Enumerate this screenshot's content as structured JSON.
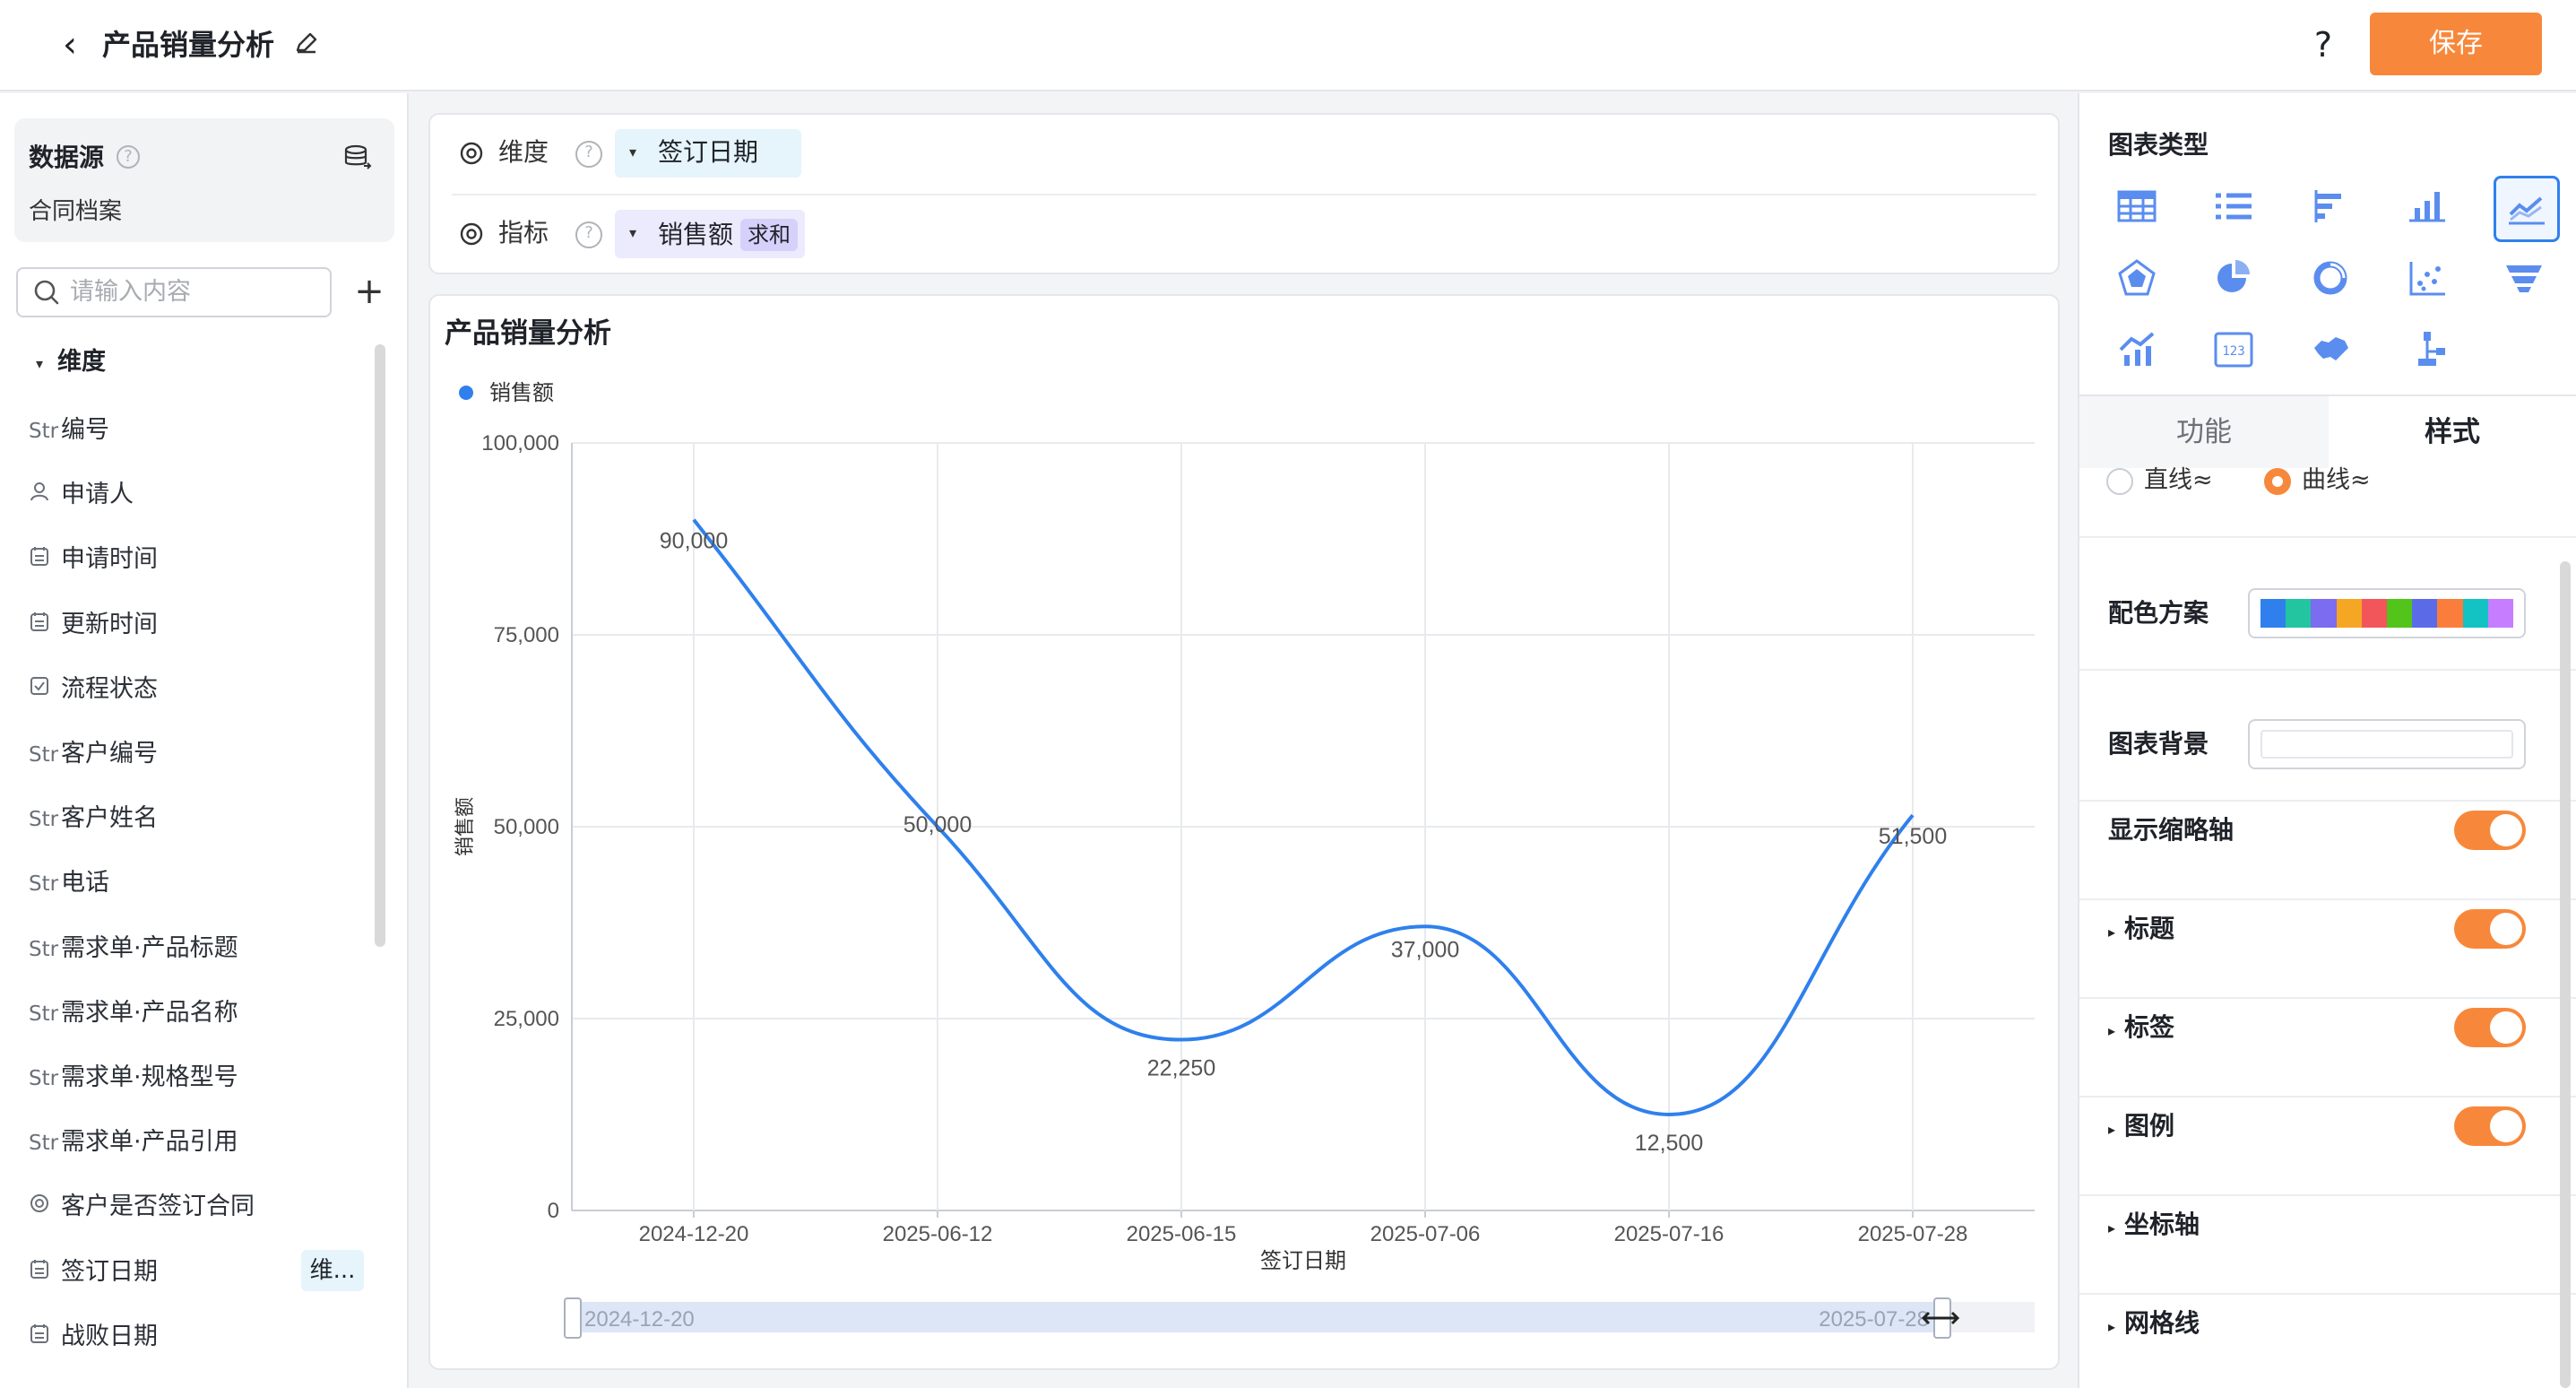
{
  "header": {
    "title": "产品销量分析",
    "help": "?",
    "save_label": "保存"
  },
  "datasource": {
    "title": "数据源",
    "name": "合同档案"
  },
  "search": {
    "placeholder": "请输入内容"
  },
  "dimensions": {
    "heading": "维度",
    "fields": [
      {
        "icon": "Str",
        "label": "编号"
      },
      {
        "icon": "user",
        "label": "申请人"
      },
      {
        "icon": "calendar",
        "label": "申请时间"
      },
      {
        "icon": "calendar",
        "label": "更新时间"
      },
      {
        "icon": "checkbox",
        "label": "流程状态"
      },
      {
        "icon": "Str",
        "label": "客户编号"
      },
      {
        "icon": "Str",
        "label": "客户姓名"
      },
      {
        "icon": "Str",
        "label": "电话"
      },
      {
        "icon": "Str",
        "label": "需求单·产品标题"
      },
      {
        "icon": "Str",
        "label": "需求单·产品名称"
      },
      {
        "icon": "Str",
        "label": "需求单·规格型号"
      },
      {
        "icon": "Str",
        "label": "需求单·产品引用"
      },
      {
        "icon": "radio",
        "label": "客户是否签订合同"
      },
      {
        "icon": "calendar",
        "label": "签订日期"
      },
      {
        "icon": "calendar",
        "label": "战败日期"
      }
    ],
    "badge": "维..."
  },
  "config": {
    "dimension_label": "维度",
    "dimension_tag": "签订日期",
    "measure_label": "指标",
    "measure_tag": "销售额",
    "measure_agg": "求和"
  },
  "chart_data": {
    "type": "line",
    "title": "产品销量分析",
    "categories": [
      "2024-12-20",
      "2025-06-12",
      "2025-06-15",
      "2025-07-06",
      "2025-07-16",
      "2025-07-28"
    ],
    "series": [
      {
        "name": "销售额",
        "values": [
          90000,
          50000,
          22250,
          37000,
          12500,
          51500
        ],
        "color": "#2f80ed"
      }
    ],
    "data_labels": [
      "90,000",
      "50,000",
      "22,250",
      "37,000",
      "12,500",
      "51,500"
    ],
    "xlabel": "签订日期",
    "ylabel": "销售额",
    "ylim": [
      0,
      100000
    ],
    "yticks": [
      "0",
      "25,000",
      "50,000",
      "75,000",
      "100,000"
    ],
    "grid": true,
    "smooth": true,
    "legend": "top-left",
    "zoom_range": {
      "start": "2024-12-20",
      "end": "2025-07-28"
    }
  },
  "right_panel": {
    "chart_type_title": "图表类型",
    "tab_function": "功能",
    "tab_style": "样式",
    "line_style_options": [
      "直线≈",
      "曲线≈"
    ],
    "selected_line_style": "曲线",
    "palette_label": "配色方案",
    "palette_colors": [
      "#2f80ed",
      "#22c5a0",
      "#7b6cf0",
      "#f5a623",
      "#f2555a",
      "#52c41a",
      "#5b6be8",
      "#fa7d3c",
      "#13c2c2",
      "#c77dff"
    ],
    "background_label": "图表背景",
    "settings": [
      {
        "label": "显示缩略轴",
        "toggle": true,
        "expandable": false
      },
      {
        "label": "标题",
        "toggle": true,
        "expandable": true
      },
      {
        "label": "标签",
        "toggle": true,
        "expandable": true
      },
      {
        "label": "图例",
        "toggle": true,
        "expandable": true
      },
      {
        "label": "坐标轴",
        "toggle": false,
        "expandable": true
      },
      {
        "label": "网格线",
        "toggle": false,
        "expandable": true
      }
    ]
  },
  "colors": {
    "accent": "#f7883b",
    "line": "#2f80ed",
    "dim_tag": "#e6f4fc",
    "measure_tag": "#eceafd"
  }
}
